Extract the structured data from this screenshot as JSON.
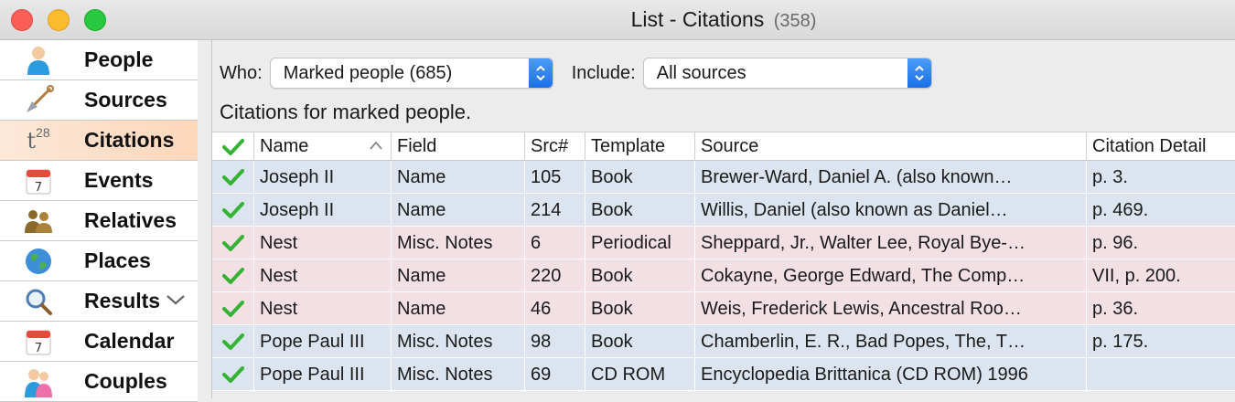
{
  "window": {
    "title": "List - Citations",
    "count": "(358)"
  },
  "sidebar": {
    "items": [
      {
        "label": "People",
        "icon": "person-icon"
      },
      {
        "label": "Sources",
        "icon": "shovel-icon"
      },
      {
        "label": "Citations",
        "icon": "citation-icon",
        "icon_text": "t28",
        "selected": true
      },
      {
        "label": "Events",
        "icon": "calendar-icon",
        "icon_text": "7"
      },
      {
        "label": "Relatives",
        "icon": "relatives-icon"
      },
      {
        "label": "Places",
        "icon": "globe-icon"
      },
      {
        "label": "Results",
        "icon": "magnifier-icon",
        "has_chevron": true
      },
      {
        "label": "Calendar",
        "icon": "calendar-icon",
        "icon_text": "7"
      },
      {
        "label": "Couples",
        "icon": "couple-icon"
      }
    ]
  },
  "filters": {
    "who_label": "Who:",
    "who_value": "Marked people (685)",
    "include_label": "Include:",
    "include_value": "All sources"
  },
  "description": "Citations for marked people.",
  "table": {
    "columns": [
      "Name",
      "Field",
      "Src#",
      "Template",
      "Source",
      "Citation Detail"
    ],
    "rows": [
      {
        "name": "Joseph II",
        "field": "Name",
        "src": "105",
        "template": "Book",
        "source": "Brewer-Ward, Daniel A. (also known…",
        "detail": "p. 3.",
        "tint": "blue"
      },
      {
        "name": "Joseph II",
        "field": "Name",
        "src": "214",
        "template": "Book",
        "source": "Willis, Daniel (also known as Daniel…",
        "detail": "p. 469.",
        "tint": "blue"
      },
      {
        "name": "Nest",
        "field": "Misc. Notes",
        "src": "6",
        "template": "Periodical",
        "source": "Sheppard, Jr., Walter Lee, Royal Bye-…",
        "detail": "p. 96.",
        "tint": "pink"
      },
      {
        "name": "Nest",
        "field": "Name",
        "src": "220",
        "template": "Book",
        "source": "Cokayne, George Edward, The Comp…",
        "detail": "VII, p. 200.",
        "tint": "pink"
      },
      {
        "name": "Nest",
        "field": "Name",
        "src": "46",
        "template": "Book",
        "source": "Weis, Frederick Lewis, Ancestral Roo…",
        "detail": "p. 36.",
        "tint": "pink"
      },
      {
        "name": "Pope Paul III",
        "field": "Misc. Notes",
        "src": "98",
        "template": "Book",
        "source": "Chamberlin, E. R., Bad Popes, The, T…",
        "detail": "p. 175.",
        "tint": "blue"
      },
      {
        "name": "Pope Paul III",
        "field": "Misc. Notes",
        "src": "69",
        "template": "CD ROM",
        "source": "Encyclopedia Brittanica (CD ROM) 1996",
        "detail": "",
        "tint": "blue"
      }
    ]
  },
  "colors": {
    "check": "#34b233",
    "selected_sidebar": "#fcd7bb",
    "row_blue": "#dce4ef",
    "row_pink": "#f2e0e4",
    "accent": "#1a6fe8"
  }
}
